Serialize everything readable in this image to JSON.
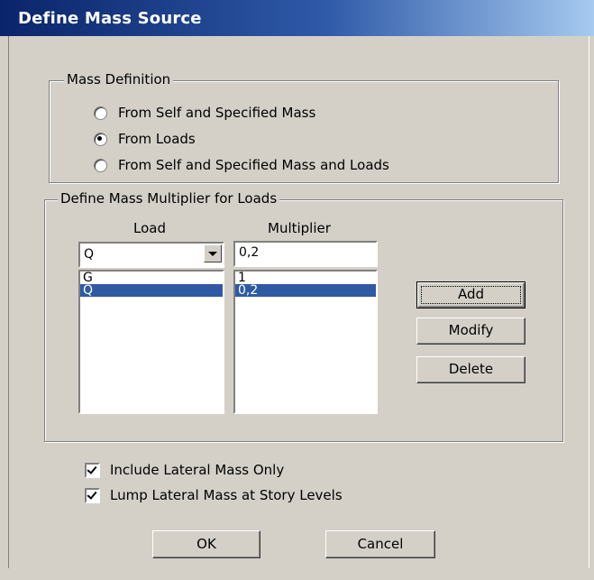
{
  "window": {
    "title": "Define Mass Source"
  },
  "mass_definition": {
    "label": "Mass Definition",
    "options": [
      {
        "label": "From Self and Specified Mass",
        "selected": false
      },
      {
        "label": "From Loads",
        "selected": true
      },
      {
        "label": "From Self and Specified Mass and Loads",
        "selected": false
      }
    ]
  },
  "multiplier_group": {
    "label": "Define Mass Multiplier for Loads",
    "load_header": "Load",
    "multiplier_header": "Multiplier",
    "load_combo_value": "Q",
    "multiplier_input_value": "0,2",
    "load_list": [
      "G",
      "Q"
    ],
    "multiplier_list": [
      "1",
      "0,2"
    ],
    "selected_index": 1,
    "add_label": "Add",
    "modify_label": "Modify",
    "delete_label": "Delete"
  },
  "options": {
    "include_lateral_label": "Include Lateral Mass Only",
    "include_lateral_checked": true,
    "lump_lateral_label": "Lump Lateral Mass at Story Levels",
    "lump_lateral_checked": true
  },
  "buttons": {
    "ok_label": "OK",
    "cancel_label": "Cancel"
  }
}
